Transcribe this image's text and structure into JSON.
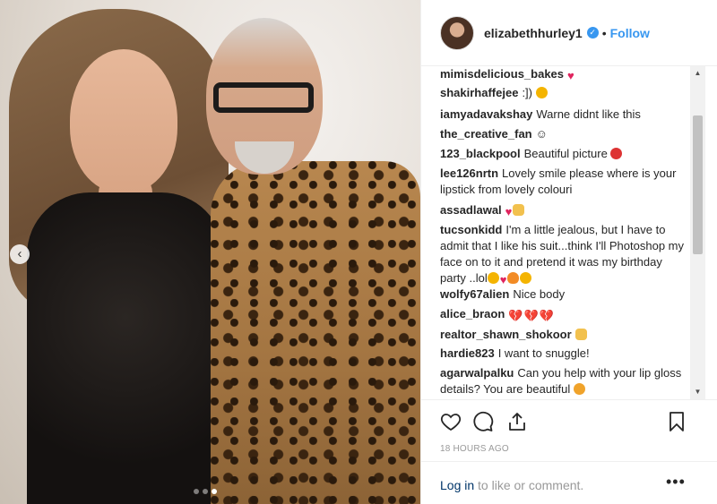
{
  "post": {
    "username": "elizabethhurley1",
    "separator": "•",
    "follow_label": "Follow",
    "verified_icon": "verified-badge-icon",
    "timestamp": "18 HOURS AGO",
    "carousel": {
      "slide_count": 3,
      "active_slide": 3
    }
  },
  "comments": [
    {
      "user": "mimisdelicious_bakes",
      "text": "",
      "emoji": [
        "heart"
      ]
    },
    {
      "user": "shakirhaffejee",
      "text": ":])",
      "emoji": [
        "smile"
      ]
    },
    {
      "user": "iamyadavakshay",
      "text": "Warne didnt like this",
      "emoji": []
    },
    {
      "user": "the_creative_fan",
      "text": "☺",
      "emoji": []
    },
    {
      "user": "123_blackpool",
      "text": "Beautiful picture",
      "emoji": [
        "rose"
      ]
    },
    {
      "user": "lee126nrtn",
      "text": "Lovely smile please where is your lipstick from lovely colouri",
      "emoji": []
    },
    {
      "user": "assadlawal",
      "text": "",
      "emoji": [
        "heart",
        "ok-hand"
      ]
    },
    {
      "user": "tucsonkidd",
      "text": "I'm a little jealous, but I have to admit that I like his suit...think I'll Photoshop my face on to it and pretend it was my birthday party ..lol",
      "emoji": [
        "wink",
        "heart",
        "flame",
        "wink"
      ]
    },
    {
      "user": "wolfy67alien",
      "text": "Nice body",
      "emoji": []
    },
    {
      "user": "alice_braon",
      "text": "",
      "emoji": [
        "broken-heart",
        "broken-heart",
        "broken-heart"
      ]
    },
    {
      "user": "realtor_shawn_shokoor",
      "text": "",
      "emoji": [
        "thumbs-up"
      ]
    },
    {
      "user": "hardie823",
      "text": "I want to snuggle!",
      "emoji": []
    },
    {
      "user": "agarwalpalku",
      "text": "Can you help with your lip gloss details? You are beautiful",
      "emoji": [
        "heart-eyes"
      ]
    }
  ],
  "actions": {
    "like_icon": "heart-icon",
    "comment_icon": "comment-icon",
    "share_icon": "share-icon",
    "save_icon": "bookmark-icon"
  },
  "footer": {
    "login_label": "Log in",
    "login_suffix": " to like or comment.",
    "more_label": "•••"
  },
  "colors": {
    "accent": "#3897f0",
    "link": "#003569",
    "muted": "#999999"
  }
}
